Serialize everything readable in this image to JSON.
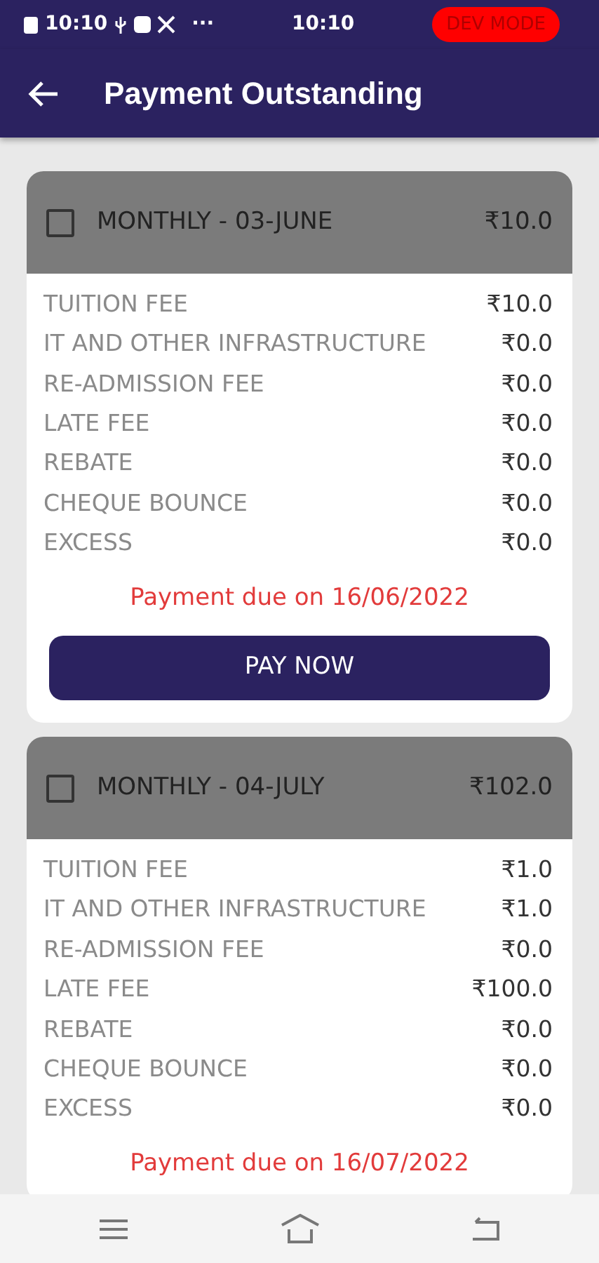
{
  "status_bar": {
    "time_left": "10:10",
    "dots": "···",
    "time_center": "10:10",
    "badge": "DEV MODE"
  },
  "app_bar": {
    "title": "Payment Outstanding"
  },
  "invoices": [
    {
      "checked": false,
      "title": "MONTHLY - 03-JUNE",
      "amount": "₹10.0",
      "fees": [
        {
          "label": "TUITION FEE",
          "amount": "₹10.0"
        },
        {
          "label": "IT AND OTHER INFRASTRUCTURE",
          "amount": "₹0.0"
        },
        {
          "label": "RE-ADMISSION FEE",
          "amount": "₹0.0"
        },
        {
          "label": "LATE FEE",
          "amount": "₹0.0"
        },
        {
          "label": "REBATE",
          "amount": "₹0.0"
        },
        {
          "label": "CHEQUE BOUNCE",
          "amount": "₹0.0"
        },
        {
          "label": "EXCESS",
          "amount": "₹0.0"
        }
      ],
      "due": "Payment due on 16/06/2022",
      "button": "PAY NOW"
    },
    {
      "checked": false,
      "title": "MONTHLY - 04-JULY",
      "amount": "₹102.0",
      "fees": [
        {
          "label": "TUITION FEE",
          "amount": "₹1.0"
        },
        {
          "label": "IT AND OTHER INFRASTRUCTURE",
          "amount": "₹1.0"
        },
        {
          "label": "RE-ADMISSION FEE",
          "amount": "₹0.0"
        },
        {
          "label": "LATE FEE",
          "amount": "₹100.0"
        },
        {
          "label": "REBATE",
          "amount": "₹0.0"
        },
        {
          "label": "CHEQUE BOUNCE",
          "amount": "₹0.0"
        },
        {
          "label": "EXCESS",
          "amount": "₹0.0"
        }
      ],
      "due": "Payment due on 16/07/2022"
    }
  ]
}
